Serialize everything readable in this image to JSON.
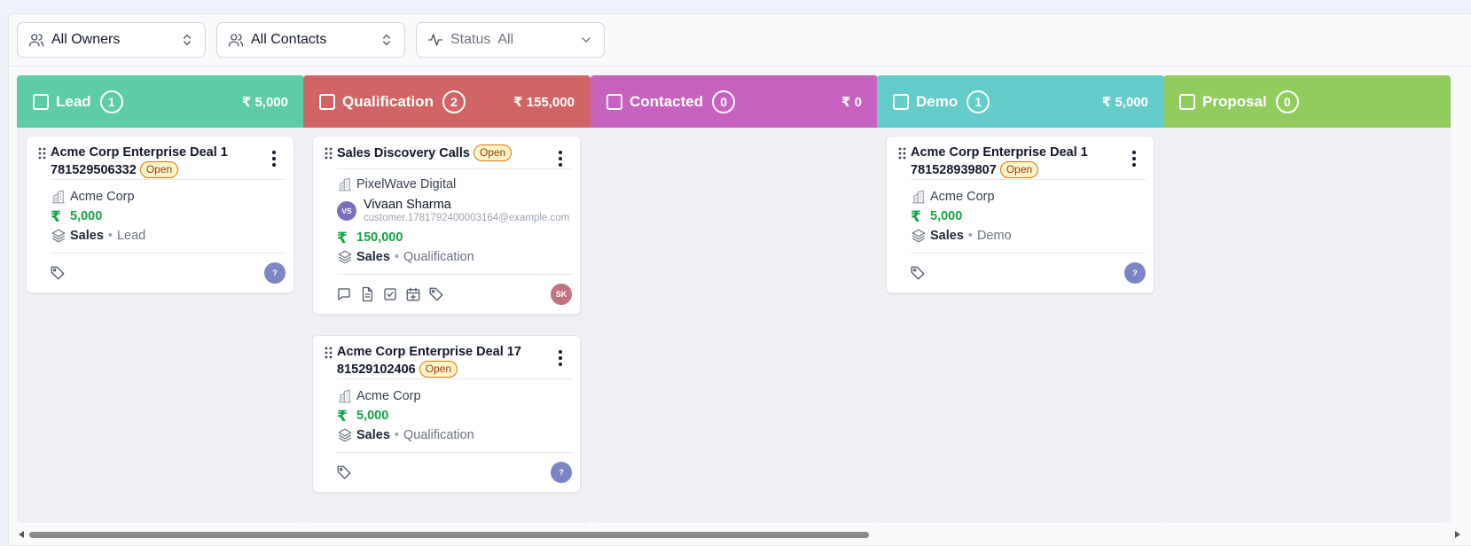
{
  "filters": {
    "owners": {
      "label": "All Owners"
    },
    "contacts": {
      "label": "All Contacts"
    },
    "status": {
      "label": "Status",
      "value": "All"
    }
  },
  "columns": [
    {
      "title": "Lead",
      "count": "1",
      "total": "₹ 5,000",
      "color": "#5ecba9"
    },
    {
      "title": "Qualification",
      "count": "2",
      "total": "₹ 155,000",
      "color": "#d16565"
    },
    {
      "title": "Contacted",
      "count": "0",
      "total": "₹ 0",
      "color": "#c763bf"
    },
    {
      "title": "Demo",
      "count": "1",
      "total": "₹ 5,000",
      "color": "#64cccb"
    },
    {
      "title": "Proposal",
      "count": "0",
      "total": "",
      "color": "#90cc5e"
    }
  ],
  "cards": {
    "lead_1": {
      "title": "Acme Corp Enterprise Deal 1 781529506332",
      "badge": "Open",
      "company": "Acme Corp",
      "amount": "5,000",
      "pipeline": "Sales",
      "stage": "Lead",
      "owner_initials": "?",
      "owner_color": "#7c86c4"
    },
    "qual_1": {
      "title": "Sales Discovery Calls",
      "badge": "Open",
      "company": "PixelWave Digital",
      "contact_initials": "VS",
      "contact_name": "Vivaan Sharma",
      "contact_email": "customer.1781792400003164@example.com",
      "amount": "150,000",
      "pipeline": "Sales",
      "stage": "Qualification",
      "owner_initials": "SK",
      "owner_color": "#c07482"
    },
    "qual_2": {
      "title": "Acme Corp Enterprise Deal 17 81529102406",
      "badge": "Open",
      "company": "Acme Corp",
      "amount": "5,000",
      "pipeline": "Sales",
      "stage": "Qualification",
      "owner_initials": "?",
      "owner_color": "#7c86c4"
    },
    "demo_1": {
      "title": "Acme Corp Enterprise Deal 1 781528939807",
      "badge": "Open",
      "company": "Acme Corp",
      "amount": "5,000",
      "pipeline": "Sales",
      "stage": "Demo",
      "owner_initials": "?",
      "owner_color": "#7c86c4"
    }
  },
  "currency_symbol": "₹",
  "dot": "•"
}
